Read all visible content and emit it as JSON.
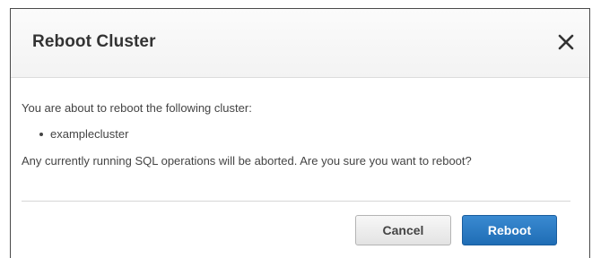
{
  "dialog": {
    "title": "Reboot Cluster",
    "message": "You are about to reboot the following cluster:",
    "cluster_name": "examplecluster",
    "warning": "Any currently running SQL operations will be aborted. Are you sure you want to reboot?",
    "close_icon": "close-icon"
  },
  "buttons": {
    "cancel_label": "Cancel",
    "reboot_label": "Reboot"
  },
  "colors": {
    "primary_button": "#1f6db5",
    "text": "#444444",
    "title": "#333333"
  }
}
